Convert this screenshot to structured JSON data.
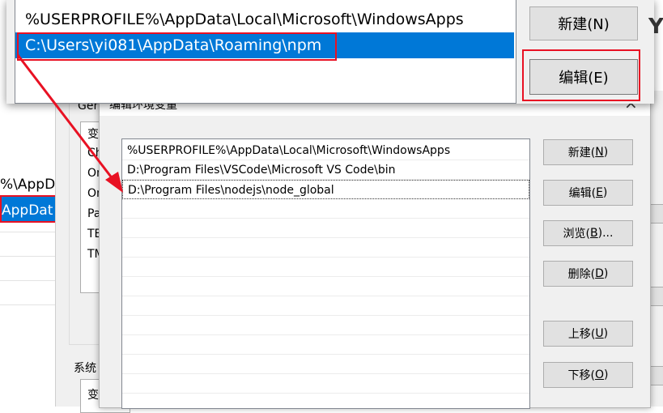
{
  "top_snippet": {
    "items": [
      "%USERPROFILE%\\AppData\\Local\\Microsoft\\WindowsApps",
      "C:\\Users\\yi081\\AppData\\Roaming\\npm"
    ],
    "new_label": "新建(N)",
    "edit_label": "编辑(E)"
  },
  "background": {
    "group_label": "Gera",
    "var_col": "变",
    "list_items": [
      "Ch",
      "On",
      "On",
      "Pa",
      "TE",
      "TM"
    ],
    "left_items": [
      "%\\AppD",
      "AppDat"
    ],
    "system_label": "系统",
    "system_var": "变"
  },
  "dialog": {
    "title": "编辑环境变量",
    "close": "×",
    "paths": [
      "%USERPROFILE%\\AppData\\Local\\Microsoft\\WindowsApps",
      "D:\\Program Files\\VSCode\\Microsoft VS Code\\bin",
      "D:\\Program Files\\nodejs\\node_global"
    ],
    "buttons": {
      "new": {
        "text": "新建(",
        "key": "N",
        "end": ")"
      },
      "edit": {
        "text": "编辑(",
        "key": "E",
        "end": ")"
      },
      "browse": {
        "text": "浏览(",
        "key": "B",
        "end": ")..."
      },
      "delete": {
        "text": "删除(",
        "key": "D",
        "end": ")"
      },
      "up": {
        "text": "上移(",
        "key": "U",
        "end": ")"
      },
      "down": {
        "text": "下移(",
        "key": "O",
        "end": ")"
      }
    }
  },
  "colors": {
    "selection": "#0078d7",
    "highlight_box": "#e81123",
    "arrow": "#e81123"
  }
}
